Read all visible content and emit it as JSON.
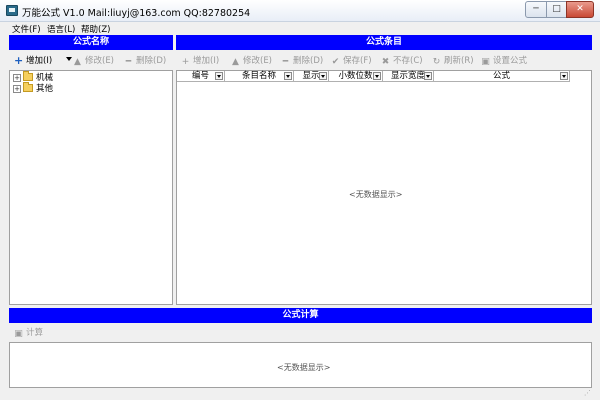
{
  "window": {
    "title": "万能公式 V1.0   Mail:liuyj@163.com QQ:82780254",
    "min_glyph": "─",
    "max_glyph": "□",
    "close_glyph": "✕"
  },
  "menu": {
    "items": [
      {
        "label": "文件(F)"
      },
      {
        "label": "语言(L)"
      },
      {
        "label": "帮助(Z)"
      }
    ]
  },
  "left_panel": {
    "header": "公式名称",
    "toolbar": {
      "add": "增加(I)",
      "edit": "修改(E)",
      "delete": "删除(D)"
    },
    "tree": [
      {
        "label": "机械",
        "expander": "+"
      },
      {
        "label": "其他",
        "expander": "+"
      }
    ]
  },
  "right_panel": {
    "header": "公式条目",
    "toolbar": {
      "add": "增加(I)",
      "edit": "修改(E)",
      "delete": "删除(D)",
      "save": "保存(F)",
      "nosave": "不存(C)",
      "refresh": "刷新(R)",
      "settings": "设置公式"
    },
    "columns": [
      "编号",
      "条目名称",
      "显示",
      "小数位数",
      "显示宽度",
      "公式"
    ],
    "empty_text": "<无数据显示>"
  },
  "bottom_panel": {
    "header": "公式计算",
    "toolbar": {
      "calculate": "计算"
    },
    "empty_text": "<无数据显示>"
  },
  "colors": {
    "header_bg": "#0000ff",
    "header_fg": "#ffffff",
    "disabled_text": "#9a9a9a"
  }
}
